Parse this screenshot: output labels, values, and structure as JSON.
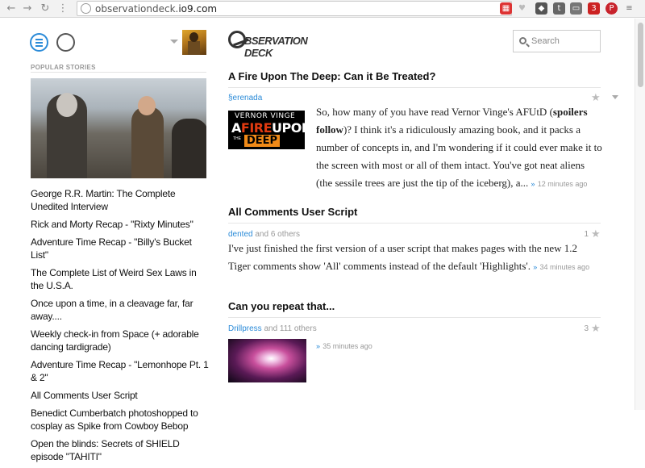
{
  "browser": {
    "url_domain": "observationdeck.",
    "url_rest": "io9.com",
    "extension_badge": "3"
  },
  "sidebar": {
    "section_label": "POPULAR STORIES",
    "stories": [
      "George R.R. Martin: The Complete Unedited Interview",
      "Rick and Morty Recap - \"Rixty Minutes\"",
      "Adventure Time Recap - \"Billy's Bucket List\"",
      "The Complete List of Weird Sex Laws in the U.S.A.",
      "Once upon a time, in a cleavage far, far away....",
      "Weekly check-in from Space (+ adorable dancing tardigrade)",
      "Adventure Time Recap - \"Lemonhope Pt. 1 & 2\"",
      "All Comments User Script",
      "Benedict Cumberbatch photoshopped to cosplay as Spike from Cowboy Bebop",
      "Open the blinds: Secrets of SHIELD episode \"TAHITI\""
    ]
  },
  "header": {
    "logo_text": "BSERVATION DECK",
    "search_placeholder": "Search"
  },
  "posts": [
    {
      "title": "A Fire Upon The Deep: Can it Be Treated?",
      "author": "§erenada",
      "others": "",
      "count": "",
      "text_a": "So, how many of you have read Vernor Vinge's AFUtD (",
      "text_bold": "spoilers follow",
      "text_b": ")? I think it's a ridiculously amazing book, and it packs a number of concepts in, and I'm wondering if it could ever make it to the screen with most or all of them intact. You've got neat aliens (the sessile trees are just the tip of the iceberg), a...",
      "more": "»",
      "age": "12 minutes ago",
      "image": {
        "line1": "VERNOR VINGE",
        "line2a": "A",
        "line2b": "FIRE",
        "line2c": "UPON",
        "line3_small": "THE",
        "line3": "DEEP"
      }
    },
    {
      "title": "All Comments User Script",
      "author": "dented",
      "others": "and 6 others",
      "count": "1",
      "text_a": "I've just finished the first version of a user script that makes pages with the new 1.2 Tiger comments show 'All' comments instead of the default 'Highlights'.",
      "more": "»",
      "age": "34 minutes ago"
    },
    {
      "title": "Can you repeat that...",
      "author": "Drillpress",
      "others": "and 111 others",
      "count": "3",
      "more": "»",
      "age": "35 minutes ago"
    }
  ],
  "icons": {
    "star": "★"
  },
  "colors": {
    "accent": "#2b8bd8",
    "text": "#111111",
    "muted": "#999999"
  }
}
